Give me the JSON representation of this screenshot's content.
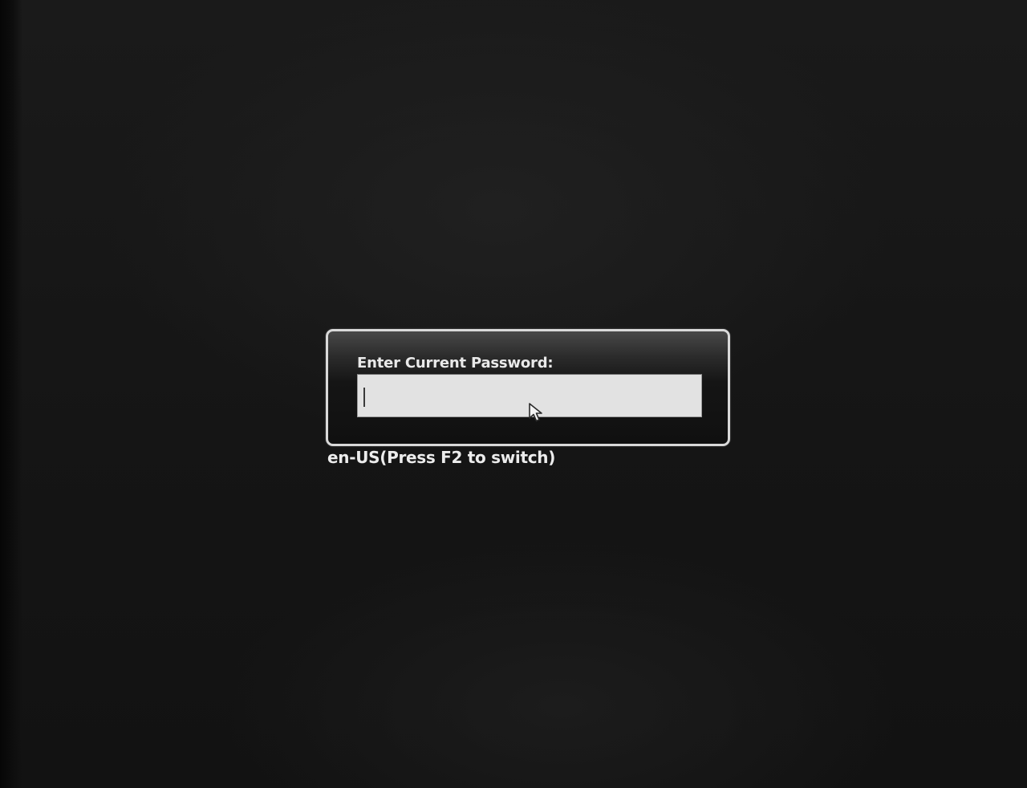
{
  "password_dialog": {
    "label": "Enter Current Password:",
    "input_value": "",
    "border_color": "#d9d9d9",
    "field_color": "#e2e2e2"
  },
  "keyboard_layout": {
    "hint": "en-US(Press F2 to switch)"
  },
  "icons": {
    "pointer": "mouse-pointer-icon",
    "caret": "text-caret-icon"
  },
  "colors": {
    "background": "#141414",
    "text": "#ececec"
  }
}
